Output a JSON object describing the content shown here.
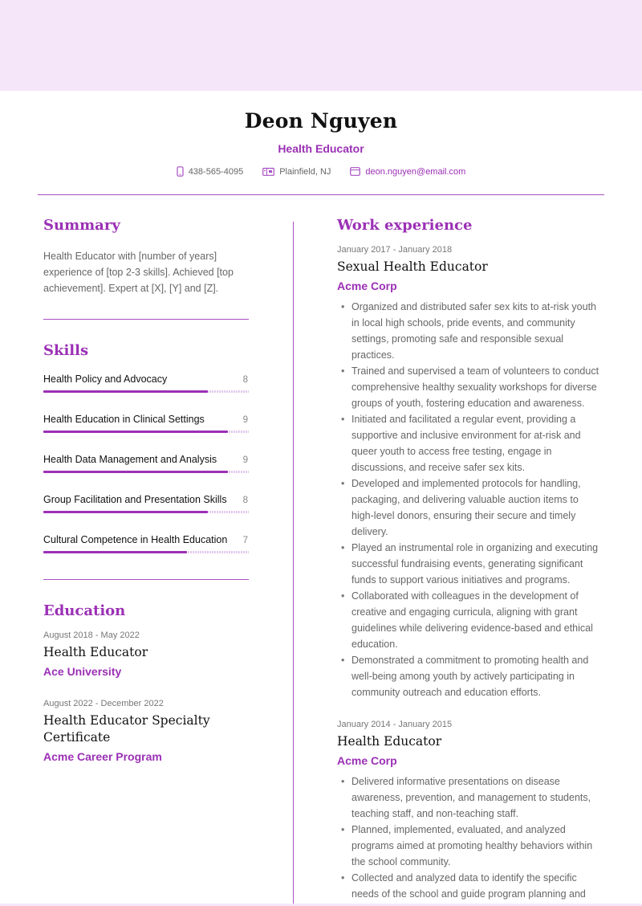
{
  "header": {
    "name": "Deon Nguyen",
    "role": "Health Educator",
    "contacts": {
      "phone": {
        "icon": "phone-icon",
        "text": "438-565-4095"
      },
      "location": {
        "icon": "map-icon",
        "text": "Plainfield, NJ"
      },
      "email": {
        "icon": "email-icon",
        "text": "deon.nguyen@email.com"
      }
    }
  },
  "colors": {
    "accent": "#9b30b5",
    "band": "#f5e6fa",
    "divider": "#a84fc3",
    "bar_track": "#e5c9ee"
  },
  "summary": {
    "title": "Summary",
    "text": "Health Educator with [number of years] experience of [top 2-3 skills]. Achieved [top achievement]. Expert at [X], [Y] and [Z]."
  },
  "skills": {
    "title": "Skills",
    "max": 10,
    "items": [
      {
        "name": "Health Policy and Advocacy",
        "value": 8
      },
      {
        "name": "Health Education in Clinical Settings",
        "value": 9
      },
      {
        "name": "Health Data Management and Analysis",
        "value": 9
      },
      {
        "name": "Group Facilitation and Presentation Skills",
        "value": 8
      },
      {
        "name": "Cultural Competence in Health Education",
        "value": 7
      }
    ]
  },
  "education": {
    "title": "Education",
    "items": [
      {
        "date": "August 2018 - May 2022",
        "degree": "Health Educator",
        "school": "Ace University"
      },
      {
        "date": "August 2022 - December 2022",
        "degree": "Health Educator Specialty Certificate",
        "school": "Acme Career Program"
      }
    ]
  },
  "work": {
    "title": "Work experience",
    "jobs": [
      {
        "date": "January 2017 - January 2018",
        "title": "Sexual Health Educator",
        "company": "Acme Corp",
        "bullets": [
          "Organized and distributed safer sex kits to at-risk youth in local high schools, pride events, and community settings, promoting safe and responsible sexual practices.",
          "Trained and supervised a team of volunteers to conduct comprehensive healthy sexuality workshops for diverse groups of youth, fostering education and awareness.",
          "Initiated and facilitated a regular event, providing a supportive and inclusive environment for at-risk and queer youth to access free testing, engage in discussions, and receive safer sex kits.",
          "Developed and implemented protocols for handling, packaging, and delivering valuable auction items to high-level donors, ensuring their secure and timely delivery.",
          "Played an instrumental role in organizing and executing successful fundraising events, generating significant funds to support various initiatives and programs.",
          "Collaborated with colleagues in the development of creative and engaging curricula, aligning with grant guidelines while delivering evidence-based and ethical education.",
          "Demonstrated a commitment to promoting health and well-being among youth by actively participating in community outreach and education efforts."
        ]
      },
      {
        "date": "January 2014 - January 2015",
        "title": "Health Educator",
        "company": "Acme Corp",
        "bullets": [
          "Delivered informative presentations on disease awareness, prevention, and management to students, teaching staff, and non-teaching staff.",
          "Planned, implemented, evaluated, and analyzed programs aimed at promoting healthy behaviors within the school community.",
          "Collected and analyzed data to identify the specific needs of the school and guide program planning and"
        ]
      }
    ]
  }
}
